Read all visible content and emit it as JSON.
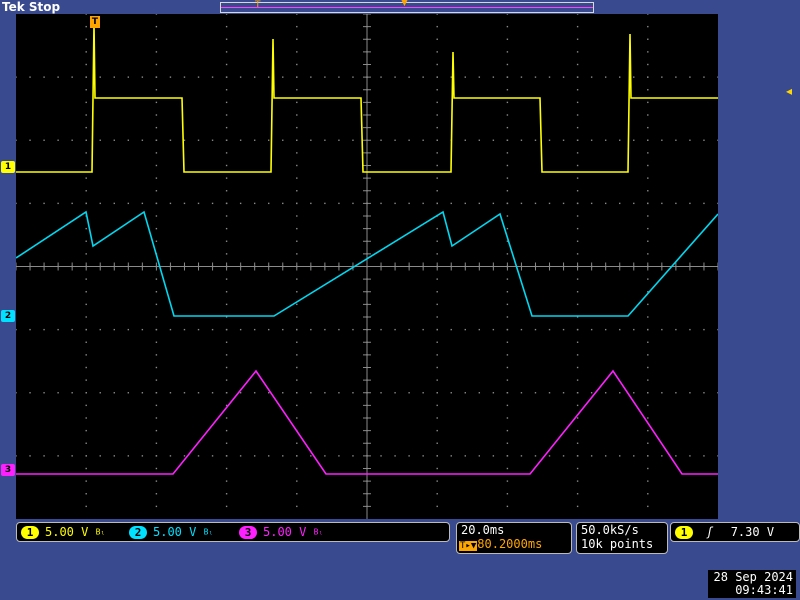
{
  "header": {
    "brand": "Tek",
    "run_state": "Stop",
    "record_marker": "T",
    "trigger_marker": "T"
  },
  "channels": [
    {
      "id": "1",
      "scale": "5.00 V",
      "color": "#ffff00",
      "marker": "1"
    },
    {
      "id": "2",
      "scale": "5.00 V",
      "color": "#00e0ff",
      "marker": "2"
    },
    {
      "id": "3",
      "scale": "5.00 V",
      "color": "#ff20ff",
      "marker": "3"
    }
  ],
  "bandwidth_icon": "Bₗ",
  "timebase": {
    "scale": "20.0ms",
    "trigger_delay_icon": "T▸▼",
    "delay": "80.2000ms"
  },
  "acquisition": {
    "sample_rate": "50.0kS/s",
    "record_length": "10k points"
  },
  "trigger": {
    "channel": "1",
    "slope_icon": "rising-edge-icon",
    "slope_glyph": "ʃ",
    "level": "7.30 V",
    "level_arrow": "◂"
  },
  "datetime": {
    "date": "28 Sep  2024",
    "time": "09:43:41"
  },
  "colors": {
    "background": "#3a4a8f",
    "screen": "#000000",
    "grid": "#8a8a8a",
    "trigger": "#ffa500"
  }
}
